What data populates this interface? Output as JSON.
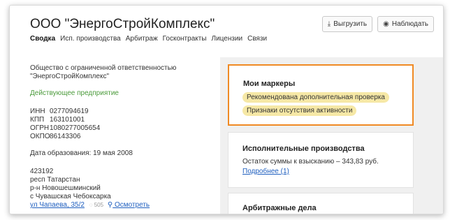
{
  "header": {
    "title": "ООО \"ЭнергоСтройКомплекс\"",
    "export_label": "Выгрузить",
    "watch_label": "Наблюдать"
  },
  "tabs": [
    {
      "label": "Сводка",
      "active": true
    },
    {
      "label": "Исп. производства",
      "active": false
    },
    {
      "label": "Арбитраж",
      "active": false
    },
    {
      "label": "Госконтракты",
      "active": false
    },
    {
      "label": "Лицензии",
      "active": false
    },
    {
      "label": "Связи",
      "active": false
    }
  ],
  "summary": {
    "full_name_line1": "Общество с ограниченной ответственностью",
    "full_name_line2": "\"ЭнергоСтройКомплекс\"",
    "status": "Действующее предприятие",
    "ids": [
      {
        "key": "ИНН",
        "value": "0277094619"
      },
      {
        "key": "КПП",
        "value": "163101001"
      },
      {
        "key": "ОГРН",
        "value": "1080277005654"
      },
      {
        "key": "ОКПО",
        "value": "86143306"
      }
    ],
    "registration": "Дата образования: 19 мая 2008",
    "address": {
      "zip": "423192",
      "region": "респ Татарстан",
      "district": "р-н Новошешминский",
      "village": "с Чувашская Чебоксарка",
      "street": "ул Чапаева, 35/2",
      "views": "505",
      "look_label": "Осмотреть"
    }
  },
  "markers": {
    "title": "Мои маркеры",
    "items": [
      "Рекомендована дополнительная проверка",
      "Признаки отсутствия активности"
    ]
  },
  "enforcement": {
    "title": "Исполнительные производства",
    "text": "Остаток суммы к взысканию – 343,83 руб.",
    "link": "Подробнее (1)"
  },
  "arbitration": {
    "title": "Арбитражные дела"
  },
  "colors": {
    "accent_orange": "#f08a24",
    "status_green": "#4a9a3a",
    "link_blue": "#1f5fbf",
    "badge_yellow": "#f6e8a6"
  }
}
